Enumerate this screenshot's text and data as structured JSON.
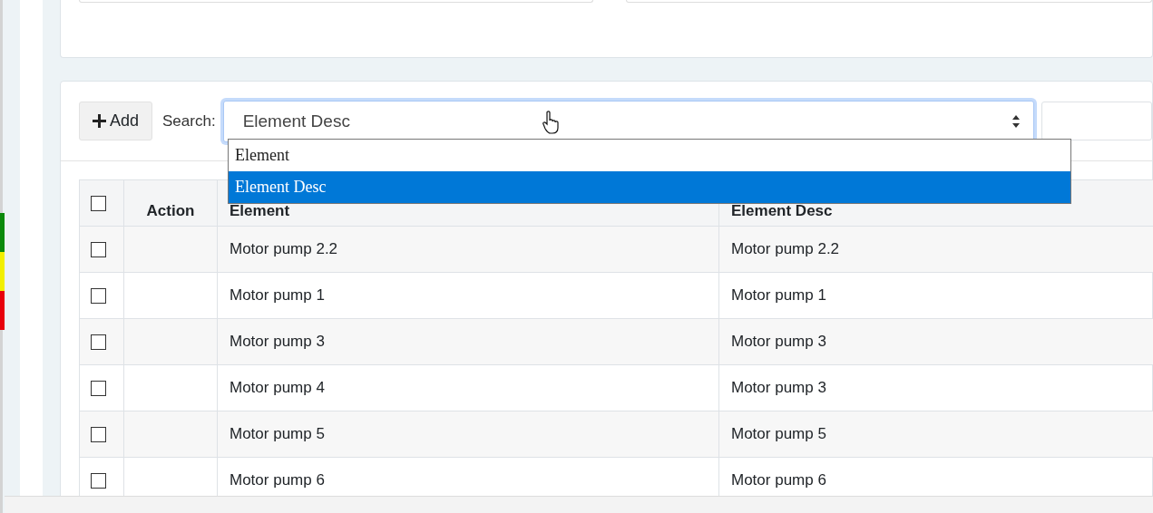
{
  "status_markers": [
    {
      "color": "#0b8a0b"
    },
    {
      "color": "#f2ef00"
    },
    {
      "color": "#e8000b"
    }
  ],
  "top_card": {
    "fields": [
      {
        "kind": "text-input"
      },
      {
        "kind": "text-input"
      }
    ]
  },
  "toolbar": {
    "add_button": "Add",
    "search_label": "Search:",
    "search_select": {
      "value": "Element Desc",
      "expanded": true,
      "options": [
        {
          "label": "Element",
          "selected": false
        },
        {
          "label": "Element Desc",
          "selected": true
        }
      ]
    },
    "filter_field": {
      "kind": "text-input"
    }
  },
  "table": {
    "select_all_checked": false,
    "columns": [
      "Action",
      "Element",
      "Element Desc"
    ],
    "rows": [
      {
        "checked": false,
        "element": "Motor pump 2.2",
        "element_desc": "Motor pump 2.2"
      },
      {
        "checked": false,
        "element": "Motor pump 1",
        "element_desc": "Motor pump 1"
      },
      {
        "checked": false,
        "element": "Motor pump 3",
        "element_desc": "Motor pump 3"
      },
      {
        "checked": false,
        "element": "Motor pump 4",
        "element_desc": "Motor pump 3"
      },
      {
        "checked": false,
        "element": "Motor pump 5",
        "element_desc": "Motor pump 5"
      },
      {
        "checked": false,
        "element": "Motor pump 6",
        "element_desc": "Motor pump 6"
      }
    ]
  }
}
